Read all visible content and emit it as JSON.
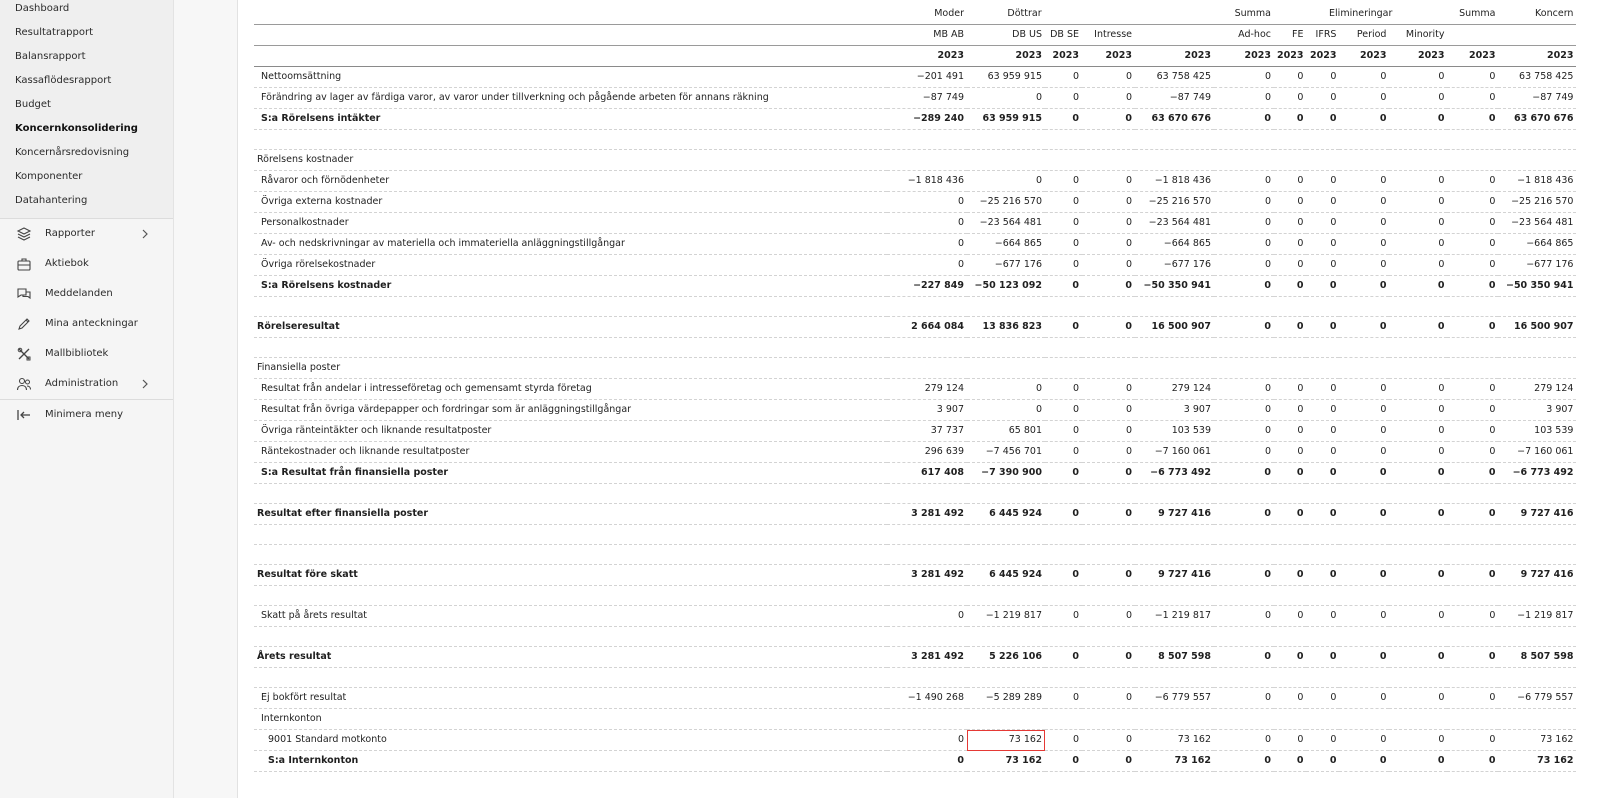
{
  "sidebar": {
    "sub_items": [
      {
        "label": "Dashboard",
        "active": false
      },
      {
        "label": "Resultatrapport",
        "active": false
      },
      {
        "label": "Balansrapport",
        "active": false
      },
      {
        "label": "Kassaflödesrapport",
        "active": false
      },
      {
        "label": "Budget",
        "active": false
      },
      {
        "label": "Koncernkonsolidering",
        "active": true
      },
      {
        "label": "Koncernårsredovisning",
        "active": false
      },
      {
        "label": "Komponenter",
        "active": false
      },
      {
        "label": "Datahantering",
        "active": false
      }
    ],
    "nav_items": [
      {
        "label": "Rapporter",
        "icon": "layers-icon",
        "chevron": true
      },
      {
        "label": "Aktiebok",
        "icon": "briefcase-icon",
        "chevron": false
      },
      {
        "label": "Meddelanden",
        "icon": "chat-icon",
        "chevron": false
      },
      {
        "label": "Mina anteckningar",
        "icon": "pencil-icon",
        "chevron": false
      },
      {
        "label": "Mallbibliotek",
        "icon": "tools-icon",
        "chevron": false
      },
      {
        "label": "Administration",
        "icon": "users-icon",
        "chevron": true
      }
    ],
    "minimize_label": "Minimera meny",
    "minimize_icon": "collapse-left-icon"
  },
  "report": {
    "header_groups": [
      "",
      "Moder",
      "Döttrar",
      "",
      "Summa",
      "Elimineringar",
      "Summa",
      "Koncern"
    ],
    "subheaders": [
      "",
      "MB AB",
      "DB US",
      "DB SE",
      "Intresse",
      "",
      "Ad-hoc",
      "FE",
      "IFRS",
      "Period",
      "Minority",
      "",
      ""
    ],
    "year_row": [
      "",
      "2023",
      "2023",
      "2023",
      "2023",
      "2023",
      "2023",
      "2023",
      "2023",
      "2023",
      "2023",
      "2023",
      "2023"
    ],
    "rows": [
      {
        "label": "Nettoomsättning",
        "indent": 1,
        "style": "normal",
        "values": [
          "−201 491",
          "63 959 915",
          "0",
          "0",
          "63 758 425",
          "0",
          "0",
          "0",
          "0",
          "0",
          "0",
          "63 758 425"
        ]
      },
      {
        "label": "Förändring av lager av färdiga varor, av varor under tillverkning och pågående arbeten för annans räkning",
        "indent": 1,
        "style": "normal",
        "values": [
          "−87 749",
          "0",
          "0",
          "0",
          "−87 749",
          "0",
          "0",
          "0",
          "0",
          "0",
          "0",
          "−87 749"
        ]
      },
      {
        "label": "S:a Rörelsens intäkter",
        "indent": 1,
        "style": "sum",
        "values": [
          "−289 240",
          "63 959 915",
          "0",
          "0",
          "63 670 676",
          "0",
          "0",
          "0",
          "0",
          "0",
          "0",
          "63 670 676"
        ]
      },
      {
        "label": "",
        "indent": 0,
        "style": "blank",
        "values": [
          "",
          "",
          "",
          "",
          "",
          "",
          "",
          "",
          "",
          "",
          "",
          ""
        ]
      },
      {
        "label": "Rörelsens kostnader",
        "indent": 0,
        "style": "heading",
        "values": [
          "",
          "",
          "",
          "",
          "",
          "",
          "",
          "",
          "",
          "",
          "",
          ""
        ]
      },
      {
        "label": "Råvaror och förnödenheter",
        "indent": 1,
        "style": "normal",
        "values": [
          "−1 818 436",
          "0",
          "0",
          "0",
          "−1 818 436",
          "0",
          "0",
          "0",
          "0",
          "0",
          "0",
          "−1 818 436"
        ]
      },
      {
        "label": "Övriga externa kostnader",
        "indent": 1,
        "style": "normal",
        "values": [
          "0",
          "−25 216 570",
          "0",
          "0",
          "−25 216 570",
          "0",
          "0",
          "0",
          "0",
          "0",
          "0",
          "−25 216 570"
        ]
      },
      {
        "label": "Personalkostnader",
        "indent": 1,
        "style": "normal",
        "values": [
          "0",
          "−23 564 481",
          "0",
          "0",
          "−23 564 481",
          "0",
          "0",
          "0",
          "0",
          "0",
          "0",
          "−23 564 481"
        ]
      },
      {
        "label": "Av- och nedskrivningar av materiella och immateriella anläggningstillgångar",
        "indent": 1,
        "style": "normal",
        "values": [
          "0",
          "−664 865",
          "0",
          "0",
          "−664 865",
          "0",
          "0",
          "0",
          "0",
          "0",
          "0",
          "−664 865"
        ]
      },
      {
        "label": "Övriga rörelsekostnader",
        "indent": 1,
        "style": "normal",
        "values": [
          "0",
          "−677 176",
          "0",
          "0",
          "−677 176",
          "0",
          "0",
          "0",
          "0",
          "0",
          "0",
          "−677 176"
        ]
      },
      {
        "label": "S:a Rörelsens kostnader",
        "indent": 1,
        "style": "sum",
        "values": [
          "−227 849",
          "−50 123 092",
          "0",
          "0",
          "−50 350 941",
          "0",
          "0",
          "0",
          "0",
          "0",
          "0",
          "−50 350 941"
        ]
      },
      {
        "label": "",
        "indent": 0,
        "style": "blank",
        "values": [
          "",
          "",
          "",
          "",
          "",
          "",
          "",
          "",
          "",
          "",
          "",
          ""
        ]
      },
      {
        "label": "Rörelseresultat",
        "indent": 0,
        "style": "sum",
        "values": [
          "2 664 084",
          "13 836 823",
          "0",
          "0",
          "16 500 907",
          "0",
          "0",
          "0",
          "0",
          "0",
          "0",
          "16 500 907"
        ]
      },
      {
        "label": "",
        "indent": 0,
        "style": "blank",
        "values": [
          "",
          "",
          "",
          "",
          "",
          "",
          "",
          "",
          "",
          "",
          "",
          ""
        ]
      },
      {
        "label": "Finansiella poster",
        "indent": 0,
        "style": "heading",
        "values": [
          "",
          "",
          "",
          "",
          "",
          "",
          "",
          "",
          "",
          "",
          "",
          ""
        ]
      },
      {
        "label": "Resultat från andelar i intresseföretag och gemensamt styrda företag",
        "indent": 1,
        "style": "normal",
        "values": [
          "279 124",
          "0",
          "0",
          "0",
          "279 124",
          "0",
          "0",
          "0",
          "0",
          "0",
          "0",
          "279 124"
        ]
      },
      {
        "label": "Resultat från övriga värdepapper och fordringar som är anläggningstillgångar",
        "indent": 1,
        "style": "normal",
        "values": [
          "3 907",
          "0",
          "0",
          "0",
          "3 907",
          "0",
          "0",
          "0",
          "0",
          "0",
          "0",
          "3 907"
        ]
      },
      {
        "label": "Övriga ränteintäkter och liknande resultatposter",
        "indent": 1,
        "style": "normal",
        "values": [
          "37 737",
          "65 801",
          "0",
          "0",
          "103 539",
          "0",
          "0",
          "0",
          "0",
          "0",
          "0",
          "103 539"
        ]
      },
      {
        "label": "Räntekostnader och liknande resultatposter",
        "indent": 1,
        "style": "normal",
        "values": [
          "296 639",
          "−7 456 701",
          "0",
          "0",
          "−7 160 061",
          "0",
          "0",
          "0",
          "0",
          "0",
          "0",
          "−7 160 061"
        ]
      },
      {
        "label": "S:a Resultat från finansiella poster",
        "indent": 1,
        "style": "sum",
        "values": [
          "617 408",
          "−7 390 900",
          "0",
          "0",
          "−6 773 492",
          "0",
          "0",
          "0",
          "0",
          "0",
          "0",
          "−6 773 492"
        ]
      },
      {
        "label": "",
        "indent": 0,
        "style": "blank",
        "values": [
          "",
          "",
          "",
          "",
          "",
          "",
          "",
          "",
          "",
          "",
          "",
          ""
        ]
      },
      {
        "label": "Resultat efter finansiella poster",
        "indent": 0,
        "style": "sum",
        "values": [
          "3 281 492",
          "6 445 924",
          "0",
          "0",
          "9 727 416",
          "0",
          "0",
          "0",
          "0",
          "0",
          "0",
          "9 727 416"
        ]
      },
      {
        "label": "",
        "indent": 0,
        "style": "blank",
        "values": [
          "",
          "",
          "",
          "",
          "",
          "",
          "",
          "",
          "",
          "",
          "",
          ""
        ]
      },
      {
        "label": "",
        "indent": 0,
        "style": "blank",
        "values": [
          "",
          "",
          "",
          "",
          "",
          "",
          "",
          "",
          "",
          "",
          "",
          ""
        ]
      },
      {
        "label": "Resultat före skatt",
        "indent": 0,
        "style": "sum",
        "values": [
          "3 281 492",
          "6 445 924",
          "0",
          "0",
          "9 727 416",
          "0",
          "0",
          "0",
          "0",
          "0",
          "0",
          "9 727 416"
        ]
      },
      {
        "label": "",
        "indent": 0,
        "style": "blank",
        "values": [
          "",
          "",
          "",
          "",
          "",
          "",
          "",
          "",
          "",
          "",
          "",
          ""
        ]
      },
      {
        "label": "Skatt på årets resultat",
        "indent": 1,
        "style": "normal",
        "values": [
          "0",
          "−1 219 817",
          "0",
          "0",
          "−1 219 817",
          "0",
          "0",
          "0",
          "0",
          "0",
          "0",
          "−1 219 817"
        ]
      },
      {
        "label": "",
        "indent": 0,
        "style": "blank",
        "values": [
          "",
          "",
          "",
          "",
          "",
          "",
          "",
          "",
          "",
          "",
          "",
          ""
        ]
      },
      {
        "label": "Årets resultat",
        "indent": 0,
        "style": "sum",
        "values": [
          "3 281 492",
          "5 226 106",
          "0",
          "0",
          "8 507 598",
          "0",
          "0",
          "0",
          "0",
          "0",
          "0",
          "8 507 598"
        ]
      },
      {
        "label": "",
        "indent": 0,
        "style": "blank",
        "values": [
          "",
          "",
          "",
          "",
          "",
          "",
          "",
          "",
          "",
          "",
          "",
          ""
        ]
      },
      {
        "label": "Ej bokfört resultat",
        "indent": 1,
        "style": "normal",
        "values": [
          "−1 490 268",
          "−5 289 289",
          "0",
          "0",
          "−6 779 557",
          "0",
          "0",
          "0",
          "0",
          "0",
          "0",
          "−6 779 557"
        ]
      },
      {
        "label": "Internkonton",
        "indent": 1,
        "style": "normal",
        "values": [
          "",
          "",
          "",
          "",
          "",
          "",
          "",
          "",
          "",
          "",
          "",
          ""
        ]
      },
      {
        "label": "9001 Standard motkonto",
        "indent": 2,
        "style": "normal",
        "highlight_col": 1,
        "values": [
          "0",
          "73 162",
          "0",
          "0",
          "73 162",
          "0",
          "0",
          "0",
          "0",
          "0",
          "0",
          "73 162"
        ]
      },
      {
        "label": "S:a Internkonton",
        "indent": 2,
        "style": "sum",
        "values": [
          "0",
          "73 162",
          "0",
          "0",
          "73 162",
          "0",
          "0",
          "0",
          "0",
          "0",
          "0",
          "73 162"
        ]
      }
    ]
  }
}
